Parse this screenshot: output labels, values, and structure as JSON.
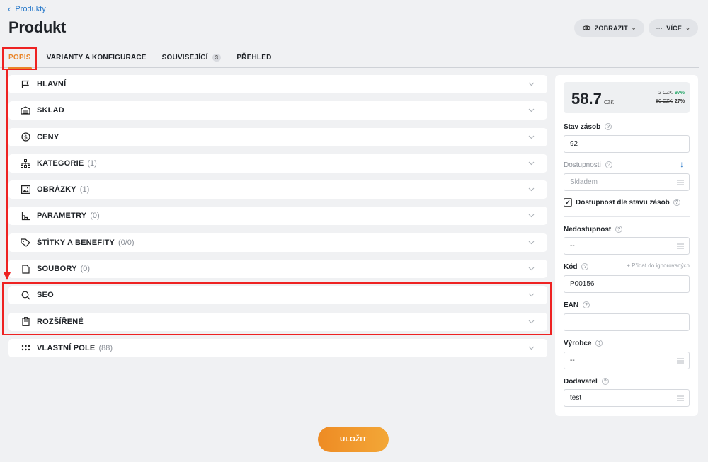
{
  "breadcrumb": {
    "label": "Produkty"
  },
  "page": {
    "title": "Produkt"
  },
  "actions": {
    "view": "ZOBRAZIT",
    "more": "VÍCE"
  },
  "tabs": [
    {
      "label": "POPIS"
    },
    {
      "label": "VARIANTY A KONFIGURACE"
    },
    {
      "label": "SOUVISEJÍCÍ",
      "badge": "3"
    },
    {
      "label": "PŘEHLED"
    }
  ],
  "sections": [
    {
      "label": "HLAVNÍ",
      "count": "",
      "icon": "flag-icon"
    },
    {
      "label": "SKLAD",
      "count": "",
      "icon": "warehouse-icon"
    },
    {
      "label": "CENY",
      "count": "",
      "icon": "dollar-circle-icon"
    },
    {
      "label": "KATEGORIE",
      "count": "(1)",
      "icon": "sitemap-icon"
    },
    {
      "label": "OBRÁZKY",
      "count": "(1)",
      "icon": "image-icon"
    },
    {
      "label": "PARAMETRY",
      "count": "(0)",
      "icon": "parameters-icon"
    },
    {
      "label": "ŠTÍTKY A BENEFITY",
      "count": "(0/0)",
      "icon": "tag-icon"
    },
    {
      "label": "SOUBORY",
      "count": "(0)",
      "icon": "file-icon"
    },
    {
      "label": "SEO",
      "count": "",
      "icon": "search-icon"
    },
    {
      "label": "ROZŠÍŘENÉ",
      "count": "",
      "icon": "clipboard-icon"
    },
    {
      "label": "VLASTNÍ POLE",
      "count": "(88)",
      "icon": "dots-grid-icon"
    }
  ],
  "panel": {
    "price": "58.7",
    "currency": "CZK",
    "row1_value": "2 CZK",
    "row1_pct": "97%",
    "row2_value": "80 CZK",
    "row2_pct": "27%",
    "stock_label": "Stav zásob",
    "stock_value": "92",
    "availability_label": "Dostupnosti",
    "availability_value": "Skladem",
    "availability_by_stock_label": "Dostupnost dle stavu zásob",
    "unavailability_label": "Nedostupnost",
    "unavailability_value": "--",
    "code_label": "Kód",
    "add_ignored_label": "+ Přidat do ignorovaných",
    "code_value": "P00156",
    "ean_label": "EAN",
    "ean_value": "",
    "manufacturer_label": "Výrobce",
    "manufacturer_value": "--",
    "supplier_label": "Dodavatel",
    "supplier_value": "test"
  },
  "save": {
    "label": "ULOŽIT"
  },
  "colors": {
    "accent": "#e9852a",
    "link": "#2477c9",
    "annotation": "#e22222"
  }
}
